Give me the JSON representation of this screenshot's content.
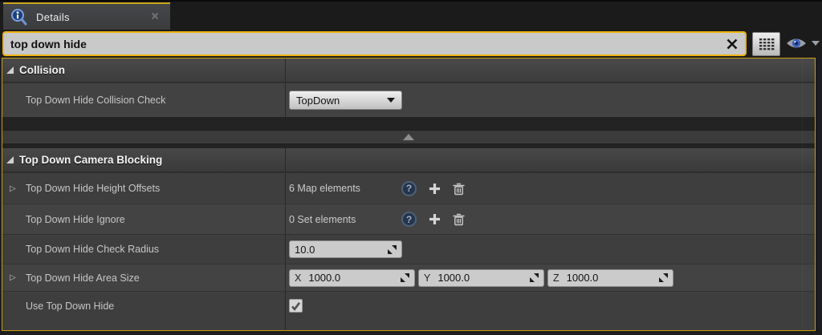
{
  "tab": {
    "title": "Details"
  },
  "search": {
    "value": "top down hide"
  },
  "icons": {
    "question_glyph": "?"
  },
  "colors": {
    "search_highlight": "#EFB310",
    "panel_border": "#C79E10",
    "row_bg_dark": "#3E3E3E",
    "row_bg_light": "#434343",
    "category_bg": "#424242",
    "eye_iris_blue": "#3F62C0",
    "tab_accent": "#CAA418"
  },
  "sections": {
    "collision": {
      "title": "Collision",
      "rows": {
        "collision_check": {
          "label": "Top Down Hide Collision Check",
          "value": "TopDown"
        }
      }
    },
    "camera_blocking": {
      "title": "Top Down Camera Blocking",
      "rows": {
        "height_offsets": {
          "label": "Top Down Hide Height Offsets",
          "value": "6 Map elements"
        },
        "ignore": {
          "label": "Top Down Hide Ignore",
          "value": "0 Set elements"
        },
        "check_radius": {
          "label": "Top Down Hide Check Radius",
          "value": "10.0"
        },
        "area_size": {
          "label": "Top Down Hide Area Size",
          "axes": {
            "x_label": "X",
            "x": "1000.0",
            "y_label": "Y",
            "y": "1000.0",
            "z_label": "Z",
            "z": "1000.0"
          }
        },
        "use_top_down_hide": {
          "label": "Use Top Down Hide",
          "checked": true
        }
      }
    }
  }
}
